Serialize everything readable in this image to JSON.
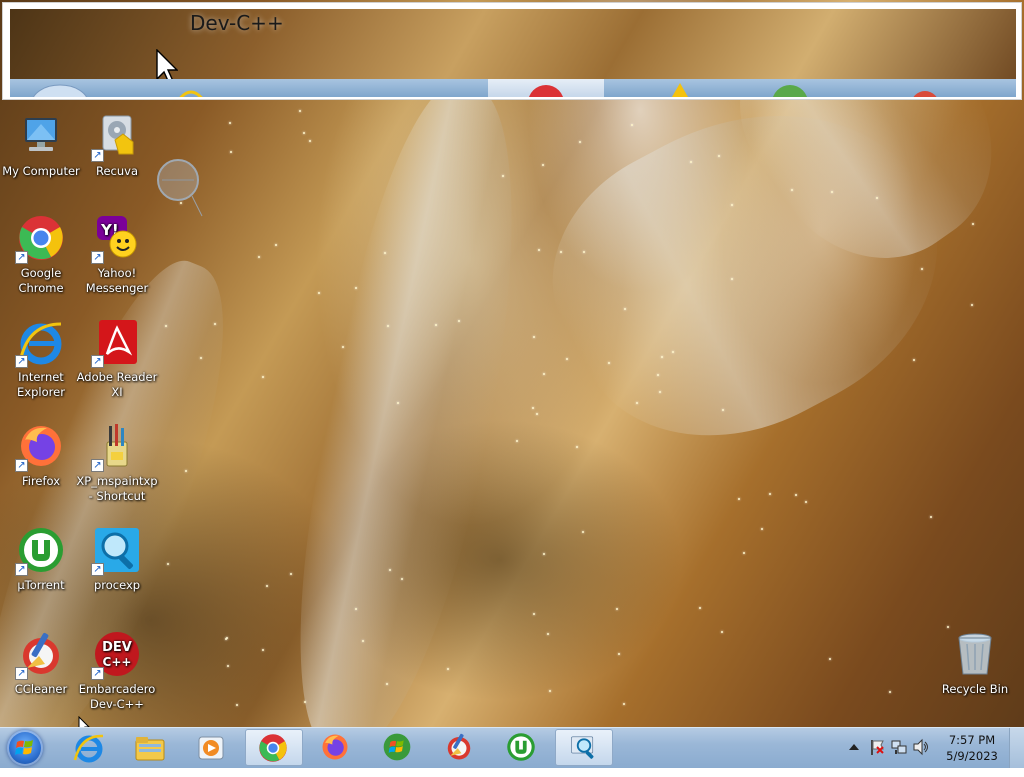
{
  "preview": {
    "title": "Dev-C++"
  },
  "desktop": {
    "icons": [
      {
        "label": "My Computer",
        "icon": "computer-icon"
      },
      {
        "label": "Recuva",
        "icon": "recuva-icon"
      },
      {
        "label": "Google Chrome",
        "icon": "chrome-icon"
      },
      {
        "label": "Yahoo! Messenger",
        "icon": "yahoo-messenger-icon"
      },
      {
        "label": "Internet Explorer",
        "icon": "internet-explorer-icon"
      },
      {
        "label": "Adobe Reader XI",
        "icon": "adobe-reader-icon"
      },
      {
        "label": "Firefox",
        "icon": "firefox-icon"
      },
      {
        "label": "XP_mspaintxp - Shortcut",
        "icon": "paint-icon"
      },
      {
        "label": "µTorrent",
        "icon": "utorrent-icon"
      },
      {
        "label": "procexp",
        "icon": "procexp-icon"
      },
      {
        "label": "CCleaner",
        "icon": "ccleaner-icon"
      },
      {
        "label": "Embarcadero Dev-C++",
        "icon": "devcpp-icon"
      },
      {
        "label": "Recycle Bin",
        "icon": "recycle-bin-icon"
      }
    ],
    "devcpp_icon_text": "DEV",
    "devcpp_icon_text2": "C++",
    "yahoo_letter": "Y!"
  },
  "taskbar": {
    "pinned": [
      {
        "name": "internet-explorer",
        "icon": "internet-explorer-icon"
      },
      {
        "name": "windows-explorer",
        "icon": "folder-icon"
      },
      {
        "name": "media-player",
        "icon": "media-player-icon"
      },
      {
        "name": "google-chrome",
        "icon": "chrome-icon",
        "active": true
      },
      {
        "name": "firefox",
        "icon": "firefox-icon"
      },
      {
        "name": "windows-start-orb",
        "icon": "windows-logo-icon"
      },
      {
        "name": "ccleaner",
        "icon": "ccleaner-icon"
      },
      {
        "name": "utorrent",
        "icon": "utorrent-icon"
      },
      {
        "name": "procexp",
        "icon": "procexp-icon",
        "active": true
      }
    ],
    "tray": {
      "time": "7:57 PM",
      "date": "5/9/2023"
    }
  },
  "colors": {
    "taskbar": "#9ab7d7",
    "chrome_red": "#db3236",
    "chrome_green": "#3cba54",
    "chrome_yellow": "#f4c20d",
    "chrome_blue": "#4885ed",
    "utorrent_green": "#2a9d32"
  }
}
